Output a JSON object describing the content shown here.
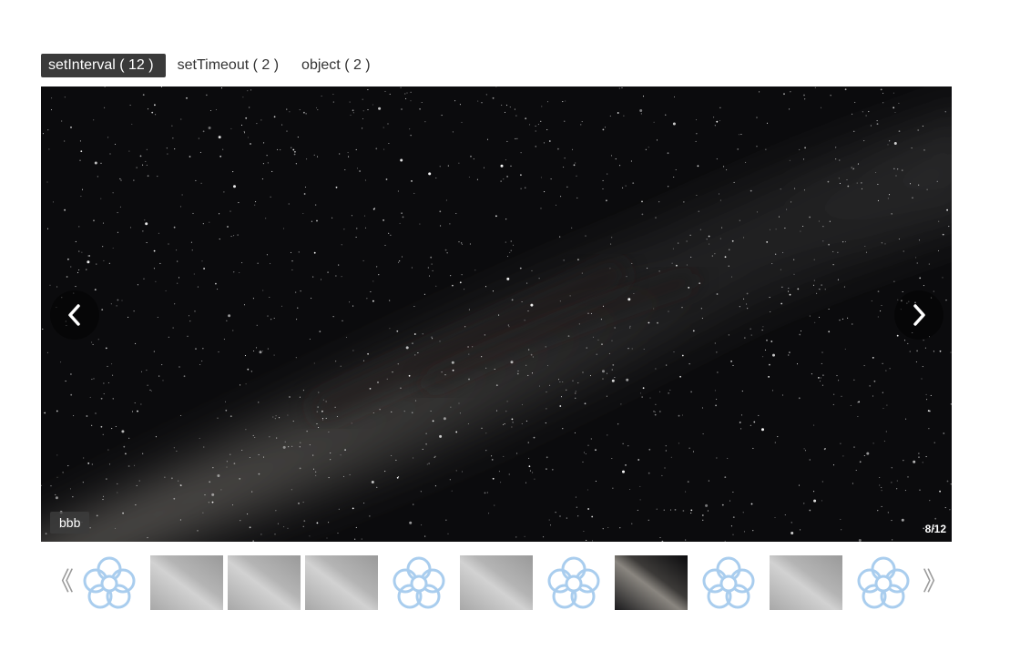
{
  "tabs": [
    {
      "label": "setInterval ( 12 )",
      "active": true
    },
    {
      "label": "setTimeout ( 2 )",
      "active": false
    },
    {
      "label": "object ( 2 )",
      "active": false
    }
  ],
  "viewer": {
    "caption": "bbb",
    "counter": "8/12",
    "prev_icon": "chevron-left-icon",
    "next_icon": "chevron-right-icon"
  },
  "thumbnails": {
    "prev_arrow": "《",
    "next_arrow": "》",
    "items": [
      {
        "kind": "placeholder-flower",
        "active": false
      },
      {
        "kind": "milky-way-gray",
        "active": false
      },
      {
        "kind": "milky-way-gray",
        "active": false
      },
      {
        "kind": "milky-way-gray",
        "active": false
      },
      {
        "kind": "placeholder-flower",
        "active": false
      },
      {
        "kind": "milky-way-gray",
        "active": false
      },
      {
        "kind": "placeholder-flower",
        "active": false
      },
      {
        "kind": "milky-way-color",
        "active": true
      },
      {
        "kind": "placeholder-flower",
        "active": false
      },
      {
        "kind": "milky-way-gray",
        "active": false
      },
      {
        "kind": "placeholder-flower",
        "active": false
      }
    ]
  },
  "colors": {
    "active_tab_bg": "#3a3a3a",
    "flower_outline": "#a9cdee",
    "arrow": "#9a9a9a"
  }
}
